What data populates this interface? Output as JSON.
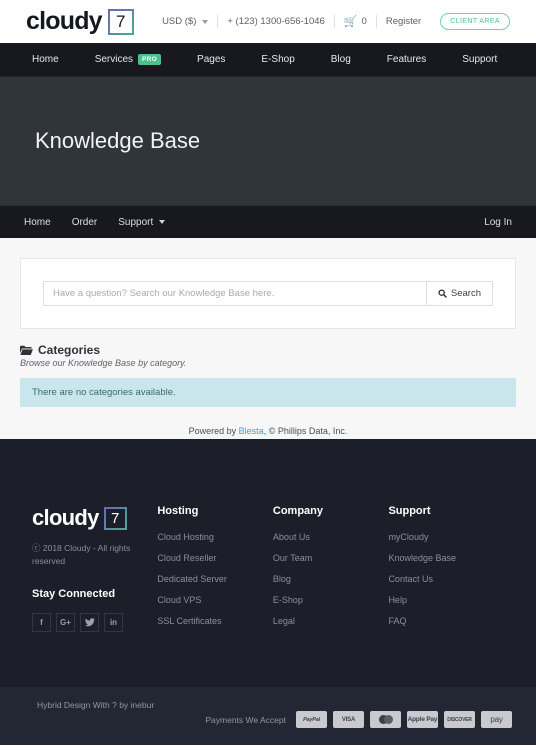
{
  "topbar": {
    "logo_word": "cloudy",
    "logo_badge": "7",
    "currency": "USD ($)",
    "phone": "+ (123) 1300-656-1046",
    "cart_count": "0",
    "register": "Register",
    "client_area": "CLIENT AREA"
  },
  "mainnav": {
    "items": [
      {
        "label": "Home",
        "badge": ""
      },
      {
        "label": "Services",
        "badge": "PRO"
      },
      {
        "label": "Pages",
        "badge": ""
      },
      {
        "label": "E-Shop",
        "badge": ""
      },
      {
        "label": "Blog",
        "badge": ""
      },
      {
        "label": "Features",
        "badge": ""
      },
      {
        "label": "Support",
        "badge": ""
      }
    ]
  },
  "hero": {
    "title": "Knowledge Base"
  },
  "subnav": {
    "items": [
      {
        "label": "Home"
      },
      {
        "label": "Order"
      },
      {
        "label": "Support"
      }
    ],
    "login": "Log In"
  },
  "search": {
    "placeholder": "Have a question? Search our Knowledge Base here.",
    "value": "",
    "button": "Search"
  },
  "categories": {
    "title": "Categories",
    "subtitle": "Browse our Knowledge Base by category.",
    "empty_message": "There are no categories available."
  },
  "powered": {
    "prefix": "Powered by ",
    "link": "Blesta",
    "suffix": ", © Phillips Data, Inc."
  },
  "footer": {
    "logo_word": "cloudy",
    "logo_badge": "7",
    "copyright": "ⓒ 2018 Cloudy - All rights reserved",
    "stay_connected": "Stay Connected",
    "socials": [
      {
        "name": "facebook-icon",
        "glyph": "f"
      },
      {
        "name": "google-plus-icon",
        "glyph": "G+"
      },
      {
        "name": "twitter-icon",
        "glyph": "🐦"
      },
      {
        "name": "linkedin-icon",
        "glyph": "in"
      }
    ],
    "columns": [
      {
        "heading": "Hosting",
        "links": [
          "Cloud Hosting",
          "Cloud Reseller",
          "Dedicated Server",
          "Cloud VPS",
          "SSL Certificates"
        ]
      },
      {
        "heading": "Company",
        "links": [
          "About Us",
          "Our Team",
          "Blog",
          "E-Shop",
          "Legal"
        ]
      },
      {
        "heading": "Support",
        "links": [
          "myCloudy",
          "Knowledge Base",
          "Contact Us",
          "Help",
          "FAQ"
        ]
      }
    ]
  },
  "bottombar": {
    "hybrid": "Hybrid Design With ? by inebur",
    "payments_label": "Payments We Accept",
    "payments": [
      "PayPal",
      "VISA",
      "Mastercard",
      "Apple Pay",
      "Discover",
      "amazon pay"
    ]
  },
  "colors": {
    "accent_green": "#4fc08d",
    "header_dark": "#17191e",
    "hero_bg": "#30353a",
    "footer_bg": "#1c1f29",
    "bottom_bg": "#232733",
    "alert_bg": "#c9e6ec",
    "link_blue": "#4b9ad6"
  }
}
